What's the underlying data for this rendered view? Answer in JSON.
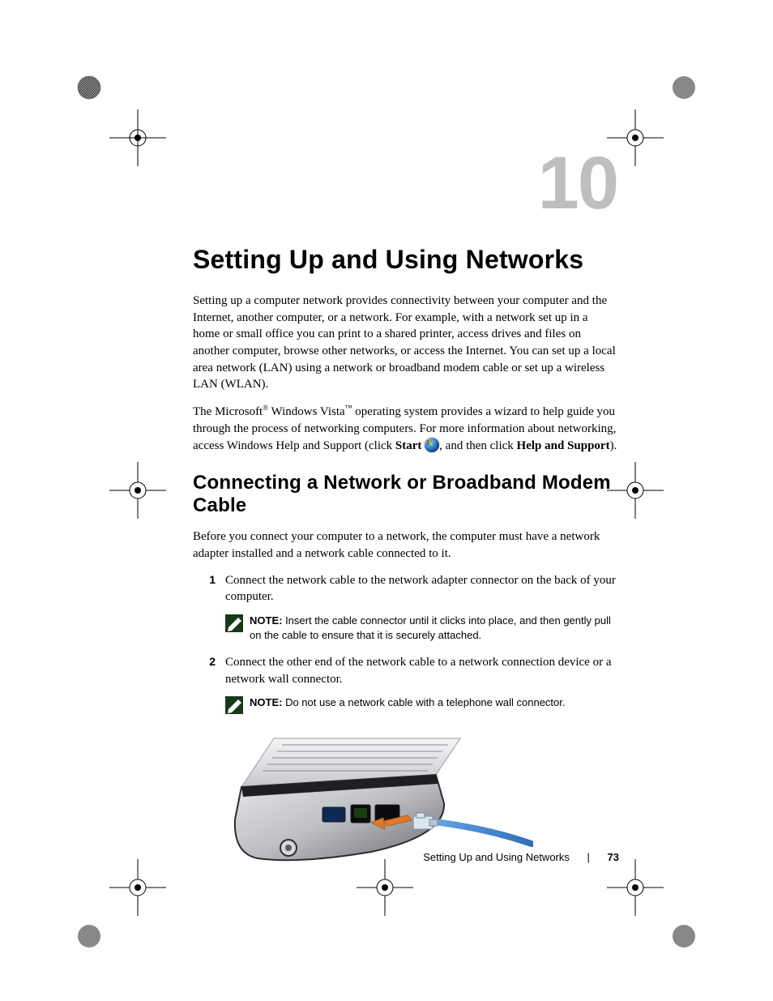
{
  "chapter_number": "10",
  "title": "Setting Up and Using Networks",
  "intro_para_1": "Setting up a computer network provides connectivity between your computer and the Internet, another computer, or a network. For example, with a network set up in a home or small office you can print to a shared printer, access drives and files on another computer, browse other networks, or access the Internet. You can set up a local area network (LAN) using a network or broadband modem cable or set up a wireless LAN (WLAN).",
  "intro_para_2_pre": "The Microsoft",
  "intro_para_2_reg": "®",
  "intro_para_2_mid1": " Windows Vista",
  "intro_para_2_tm": "™",
  "intro_para_2_mid2": " operating system provides a wizard to help guide you through the process of networking computers. For more information about networking, access Windows Help and Support (click ",
  "intro_para_2_start": "Start",
  "intro_para_2_post1": " ",
  "intro_para_2_post2": ", and then click ",
  "intro_para_2_help": "Help and Support",
  "intro_para_2_end": ").",
  "h2": "Connecting a Network or Broadband Modem Cable",
  "h2_intro": "Before you connect your computer to a network, the computer must have a network adapter installed and a network cable connected to it.",
  "steps": [
    {
      "n": "1",
      "text": "Connect the network cable to the network adapter connector on the back of your computer."
    },
    {
      "n": "2",
      "text": "Connect the other end of the network cable to a network connection device or a network wall connector."
    }
  ],
  "notes": [
    {
      "label": "NOTE:",
      "text": " Insert the cable connector until it clicks into place, and then gently pull on the cable to ensure that it is securely attached."
    },
    {
      "label": "NOTE:",
      "text": " Do not use a network cable with a telephone wall connector."
    }
  ],
  "footer": {
    "section": "Setting Up and Using Networks",
    "page": "73"
  }
}
